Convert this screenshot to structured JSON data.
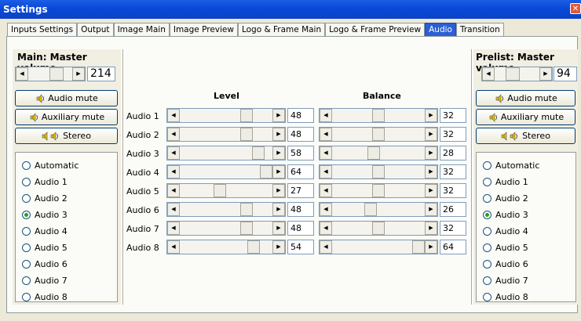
{
  "window": {
    "title": "Settings"
  },
  "tabs": [
    "Inputs Settings",
    "Output",
    "Image Main",
    "Image Preview",
    "Logo & Frame Main",
    "Logo & Frame Preview",
    "Audio",
    "Transition"
  ],
  "active_tab": "Audio",
  "main": {
    "title": "Main: Master volume",
    "volume": "214",
    "volume_fraction": 0.72,
    "buttons": {
      "mute": "Audio mute",
      "aux": "Auxiliary mute",
      "stereo": "Stereo"
    },
    "radios": [
      "Automatic",
      "Audio 1",
      "Audio 2",
      "Audio 3",
      "Audio 4",
      "Audio 5",
      "Audio 6",
      "Audio 7",
      "Audio 8"
    ],
    "selected": "Audio 3"
  },
  "prelist": {
    "title": "Prelist: Master volume",
    "volume": "94",
    "volume_fraction": 0.37,
    "buttons": {
      "mute": "Audio mute",
      "aux": "Auxiliary mute",
      "stereo": "Stereo"
    },
    "radios": [
      "Automatic",
      "Audio 1",
      "Audio 2",
      "Audio 3",
      "Audio 4",
      "Audio 5",
      "Audio 6",
      "Audio 7",
      "Audio 8"
    ],
    "selected": "Audio 3"
  },
  "headers": {
    "level": "Level",
    "balance": "Balance"
  },
  "channels": [
    {
      "label": "Audio 1",
      "level": "48",
      "balance": "32"
    },
    {
      "label": "Audio 2",
      "level": "48",
      "balance": "32"
    },
    {
      "label": "Audio 3",
      "level": "58",
      "balance": "28"
    },
    {
      "label": "Audio 4",
      "level": "64",
      "balance": "32"
    },
    {
      "label": "Audio 5",
      "level": "27",
      "balance": "32"
    },
    {
      "label": "Audio 6",
      "level": "48",
      "balance": "26"
    },
    {
      "label": "Audio 7",
      "level": "48",
      "balance": "32"
    },
    {
      "label": "Audio 8",
      "level": "54",
      "balance": "64"
    }
  ],
  "ranges": {
    "level_max": 64,
    "balance_max": 64
  },
  "colors": {
    "titlebar": "#0a48d8",
    "active_tab": "#2a5fd6",
    "radio_dot": "#21a121"
  }
}
